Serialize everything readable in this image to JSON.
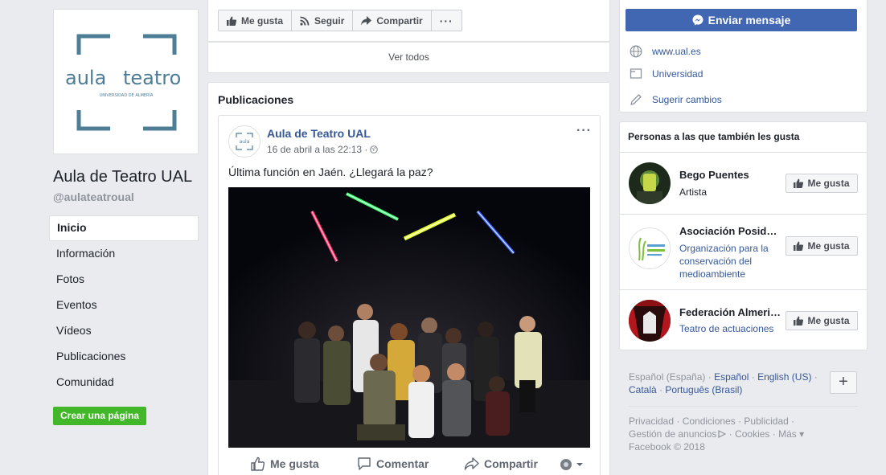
{
  "page": {
    "name": "Aula de Teatro UAL",
    "handle": "@aulateatroual",
    "logo_word1": "aula",
    "logo_word2": "teatro",
    "logo_sub": "UNIVERSIDAD DE ALMERÍA"
  },
  "nav": {
    "items": [
      "Inicio",
      "Información",
      "Fotos",
      "Eventos",
      "Vídeos",
      "Publicaciones",
      "Comunidad"
    ],
    "create_label": "Crear una página"
  },
  "action_bar": {
    "like": "Me gusta",
    "follow": "Seguir",
    "share": "Compartir",
    "more": "···"
  },
  "ver_todos": "Ver todos",
  "publicaciones": {
    "title": "Publicaciones",
    "post": {
      "author": "Aula de Teatro UAL",
      "time": "16 de abril a las 22:13 · ",
      "text": "Última función en Jaén. ¿Llegará la paz?",
      "more": "···",
      "actions": {
        "like": "Me gusta",
        "comment": "Comentar",
        "share": "Compartir"
      }
    }
  },
  "sidebar": {
    "message_button": "Enviar mensaje",
    "website": "www.ual.es",
    "category": "Universidad",
    "suggest": "Sugerir cambios",
    "likes_title": "Personas a las que también les gusta",
    "like_button": "Me gusta",
    "likes": [
      {
        "name": "Bego Puentes",
        "sub": "Artista",
        "sub_is_link": false
      },
      {
        "name": "Asociación Posidonia",
        "sub": "Organización para la conservación del medioambiente",
        "sub_is_link": true
      },
      {
        "name": "Federación Almeriense",
        "sub": "Teatro de actuaciones",
        "sub_is_link": true
      }
    ]
  },
  "languages": {
    "current": "Español (España)",
    "others": [
      "Español",
      "English (US)",
      "Català",
      "Português (Brasil)"
    ],
    "plus": "+"
  },
  "footer": {
    "links": [
      "Privacidad",
      "Condiciones",
      "Publicidad",
      "Gestión de anuncios",
      "Cookies",
      "Más"
    ],
    "copyright": "Facebook © 2018"
  },
  "colors": {
    "fb_blue": "#4267b2",
    "link": "#365899",
    "green": "#42b72a",
    "logo": "#4e7d96"
  }
}
